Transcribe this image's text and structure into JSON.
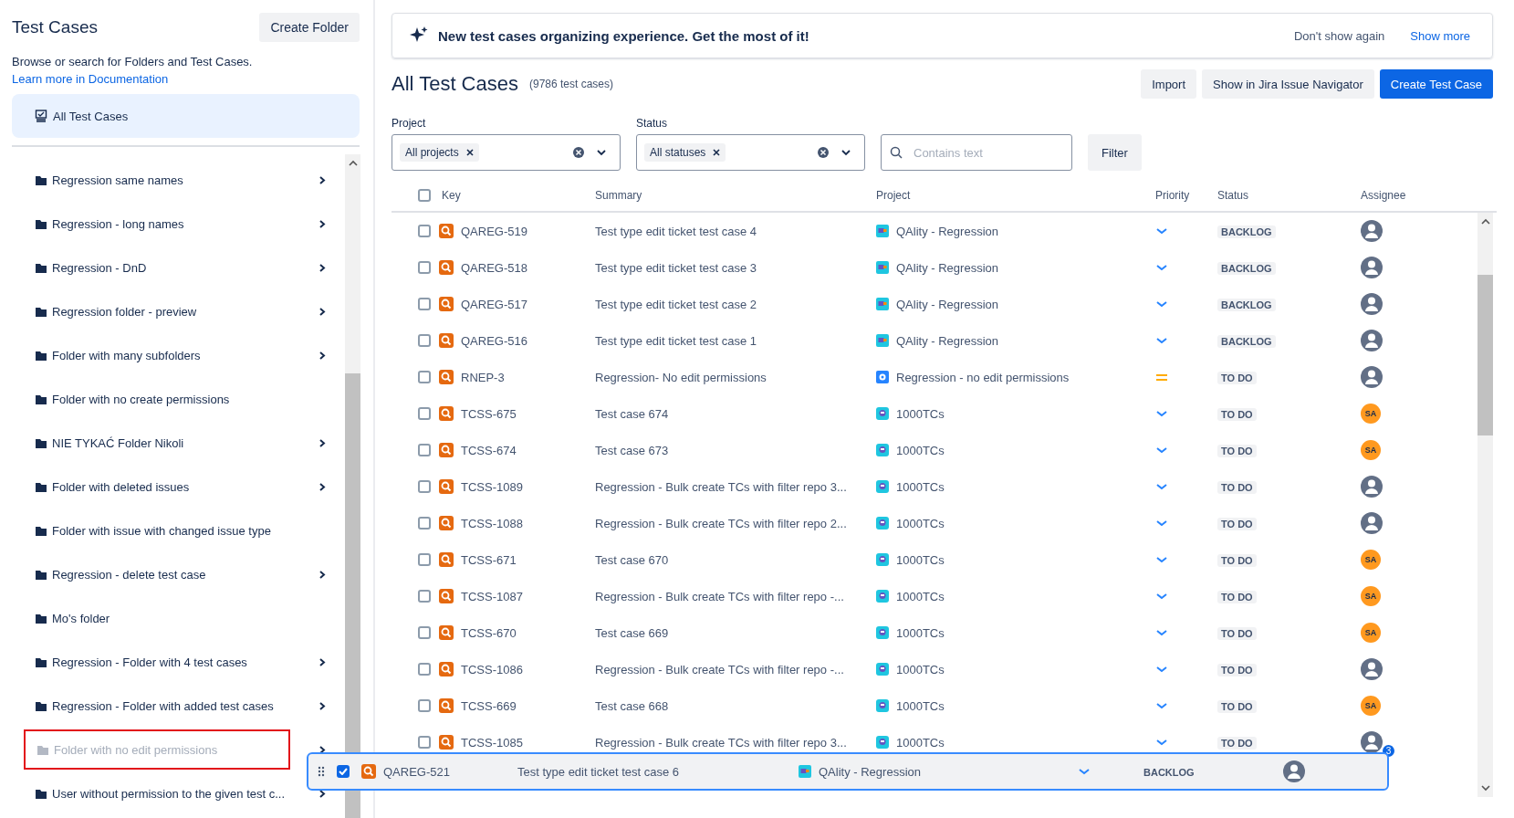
{
  "sidebar": {
    "title": "Test Cases",
    "create_button": "Create Folder",
    "description": "Browse or search for Folders and Test Cases.",
    "doc_link": "Learn more in Documentation",
    "all_item": {
      "label": "All Test Cases",
      "selected": true
    },
    "folders": [
      {
        "label": "Regression same names",
        "has_children": true,
        "disabled": false
      },
      {
        "label": "Regression - long names",
        "has_children": true,
        "disabled": false
      },
      {
        "label": "Regression - DnD",
        "has_children": true,
        "disabled": false
      },
      {
        "label": "Regression folder - preview",
        "has_children": true,
        "disabled": false
      },
      {
        "label": "Folder with many subfolders",
        "has_children": true,
        "disabled": false
      },
      {
        "label": "Folder with no create permissions",
        "has_children": false,
        "disabled": false
      },
      {
        "label": "NIE TYKAĆ Folder Nikoli",
        "has_children": true,
        "disabled": false
      },
      {
        "label": "Folder with deleted issues",
        "has_children": true,
        "disabled": false
      },
      {
        "label": "Folder with issue with changed issue type",
        "has_children": false,
        "disabled": false
      },
      {
        "label": "Regression - delete test case",
        "has_children": true,
        "disabled": false
      },
      {
        "label": "Mo's folder",
        "has_children": false,
        "disabled": false
      },
      {
        "label": "Regression - Folder with 4 test cases",
        "has_children": true,
        "disabled": false
      },
      {
        "label": "Regression - Folder with added test cases",
        "has_children": true,
        "disabled": false
      },
      {
        "label": "Folder with no edit permissions",
        "has_children": true,
        "disabled": true,
        "highlighted": true
      },
      {
        "label": "User without permission to the given test c...",
        "has_children": true,
        "disabled": false
      }
    ]
  },
  "banner": {
    "text": "New test cases organizing experience. Get the most of it!",
    "dismiss": "Don't show again",
    "more": "Show more"
  },
  "header": {
    "title": "All Test Cases",
    "count": "(9786 test cases)",
    "buttons": [
      {
        "label": "Import",
        "kind": "secondary"
      },
      {
        "label": "Show in Jira Issue Navigator",
        "kind": "secondary"
      },
      {
        "label": "Create Test Case",
        "kind": "primary"
      }
    ]
  },
  "filters": {
    "project": {
      "label": "Project",
      "tag": "All projects"
    },
    "status": {
      "label": "Status",
      "tag": "All statuses"
    },
    "search": {
      "placeholder": "Contains text"
    },
    "button": "Filter"
  },
  "table": {
    "columns": [
      "Key",
      "Summary",
      "Project",
      "Priority",
      "Status",
      "Assignee"
    ],
    "all_checked": false,
    "rows": [
      {
        "checked": false,
        "key": "QAREG-519",
        "summary": "Test type edit ticket test case 4",
        "project": {
          "name": "QAlity - Regression",
          "kind": "qality"
        },
        "priority": {
          "kind": "low"
        },
        "status": "BACKLOG",
        "assignee": {
          "kind": "generic"
        }
      },
      {
        "checked": false,
        "key": "QAREG-518",
        "summary": "Test type edit ticket test case 3",
        "project": {
          "name": "QAlity - Regression",
          "kind": "qality"
        },
        "priority": {
          "kind": "low"
        },
        "status": "BACKLOG",
        "assignee": {
          "kind": "generic"
        }
      },
      {
        "checked": false,
        "key": "QAREG-517",
        "summary": "Test type edit ticket test case 2",
        "project": {
          "name": "QAlity - Regression",
          "kind": "qality"
        },
        "priority": {
          "kind": "low"
        },
        "status": "BACKLOG",
        "assignee": {
          "kind": "generic"
        }
      },
      {
        "checked": false,
        "key": "QAREG-516",
        "summary": "Test type edit ticket test case 1",
        "project": {
          "name": "QAlity - Regression",
          "kind": "qality"
        },
        "priority": {
          "kind": "low"
        },
        "status": "BACKLOG",
        "assignee": {
          "kind": "generic"
        }
      },
      {
        "checked": false,
        "key": "RNEP-3",
        "summary": "Regression- No edit permissions",
        "project": {
          "name": "Regression - no edit permissions",
          "kind": "regression"
        },
        "priority": {
          "kind": "medium"
        },
        "status": "TO DO",
        "assignee": {
          "kind": "generic"
        }
      },
      {
        "checked": false,
        "key": "TCSS-675",
        "summary": "Test case 674",
        "project": {
          "name": "1000TCs",
          "kind": "tcs"
        },
        "priority": {
          "kind": "low"
        },
        "status": "TO DO",
        "assignee": {
          "kind": "initials",
          "initials": "SA"
        }
      },
      {
        "checked": false,
        "key": "TCSS-674",
        "summary": "Test case 673",
        "project": {
          "name": "1000TCs",
          "kind": "tcs"
        },
        "priority": {
          "kind": "low"
        },
        "status": "TO DO",
        "assignee": {
          "kind": "initials",
          "initials": "SA"
        }
      },
      {
        "checked": false,
        "key": "TCSS-1089",
        "summary": "Regression - Bulk create TCs with filter repo 3...",
        "project": {
          "name": "1000TCs",
          "kind": "tcs"
        },
        "priority": {
          "kind": "low"
        },
        "status": "TO DO",
        "assignee": {
          "kind": "generic"
        }
      },
      {
        "checked": false,
        "key": "TCSS-1088",
        "summary": "Regression - Bulk create TCs with filter repo 2...",
        "project": {
          "name": "1000TCs",
          "kind": "tcs"
        },
        "priority": {
          "kind": "low"
        },
        "status": "TO DO",
        "assignee": {
          "kind": "generic"
        }
      },
      {
        "checked": false,
        "key": "TCSS-671",
        "summary": "Test case 670",
        "project": {
          "name": "1000TCs",
          "kind": "tcs"
        },
        "priority": {
          "kind": "low"
        },
        "status": "TO DO",
        "assignee": {
          "kind": "initials",
          "initials": "SA"
        }
      },
      {
        "checked": false,
        "key": "TCSS-1087",
        "summary": "Regression - Bulk create TCs with filter repo -...",
        "project": {
          "name": "1000TCs",
          "kind": "tcs"
        },
        "priority": {
          "kind": "low"
        },
        "status": "TO DO",
        "assignee": {
          "kind": "initials",
          "initials": "SA"
        }
      },
      {
        "checked": false,
        "key": "TCSS-670",
        "summary": "Test case 669",
        "project": {
          "name": "1000TCs",
          "kind": "tcs"
        },
        "priority": {
          "kind": "low"
        },
        "status": "TO DO",
        "assignee": {
          "kind": "initials",
          "initials": "SA"
        }
      },
      {
        "checked": false,
        "key": "TCSS-1086",
        "summary": "Regression - Bulk create TCs with filter repo -...",
        "project": {
          "name": "1000TCs",
          "kind": "tcs"
        },
        "priority": {
          "kind": "low"
        },
        "status": "TO DO",
        "assignee": {
          "kind": "generic"
        }
      },
      {
        "checked": false,
        "key": "TCSS-669",
        "summary": "Test case 668",
        "project": {
          "name": "1000TCs",
          "kind": "tcs"
        },
        "priority": {
          "kind": "low"
        },
        "status": "TO DO",
        "assignee": {
          "kind": "initials",
          "initials": "SA"
        }
      },
      {
        "checked": false,
        "key": "TCSS-1085",
        "summary": "Regression - Bulk create TCs with filter repo 3...",
        "project": {
          "name": "1000TCs",
          "kind": "tcs"
        },
        "priority": {
          "kind": "low"
        },
        "status": "TO DO",
        "assignee": {
          "kind": "generic"
        }
      }
    ]
  },
  "drag_row": {
    "checked": true,
    "key": "QAREG-521",
    "summary": "Test type edit ticket test case 6",
    "project": {
      "name": "QAlity - Regression",
      "kind": "qality"
    },
    "priority": {
      "kind": "low"
    },
    "status": "BACKLOG",
    "assignee": {
      "kind": "generic"
    },
    "count_badge": "3"
  }
}
